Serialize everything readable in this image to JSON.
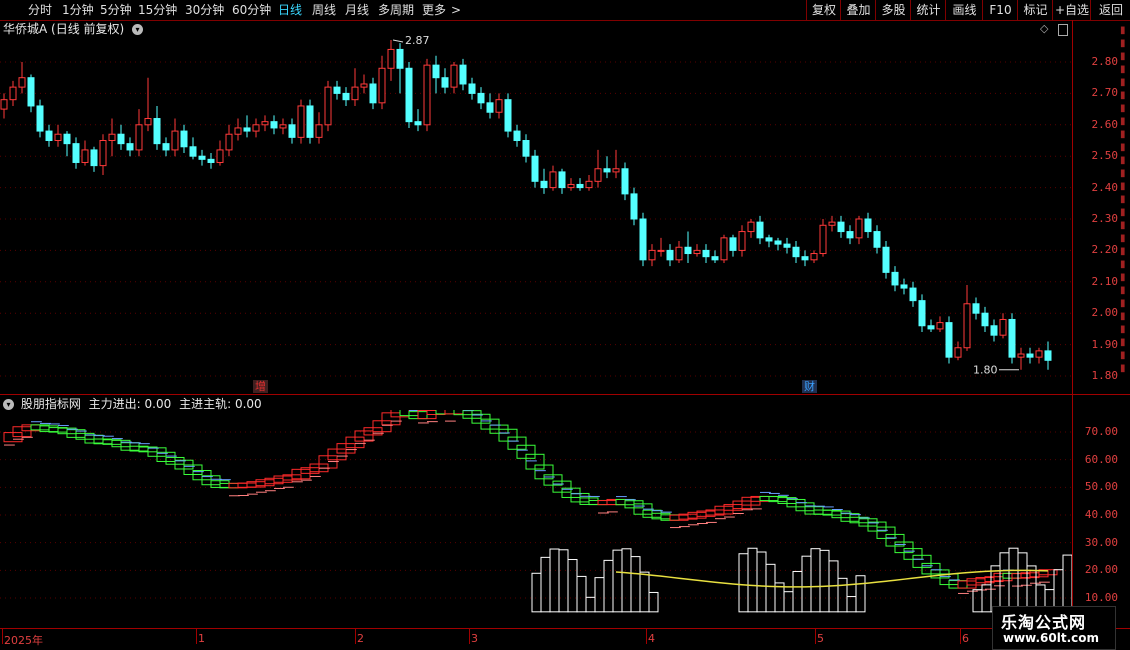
{
  "toolbar": {
    "periods": [
      "分时",
      "1分钟",
      "5分钟",
      "15分钟",
      "30分钟",
      "60分钟",
      "日线",
      "周线",
      "月线",
      "多周期",
      "更多"
    ],
    "active_index": 6,
    "more_arrow": ">",
    "right_buttons": [
      "复权",
      "叠加",
      "多股",
      "统计",
      "画线",
      "F10",
      "标记",
      "+自选",
      "返回"
    ]
  },
  "main_panel": {
    "title": "华侨城A",
    "subtitle": "(日线 前复权)",
    "high_label": "2.87",
    "low_label": "1.80",
    "price_ticks": [
      "2.80",
      "2.70",
      "2.60",
      "2.50",
      "2.40",
      "2.30",
      "2.20",
      "2.10",
      "2.00",
      "1.90",
      "1.80"
    ],
    "tags": [
      {
        "text": "增",
        "color": "#e03030"
      },
      {
        "text": "财",
        "color": "#3aa0ff"
      }
    ]
  },
  "indicator_panel": {
    "name": "股朋指标网",
    "line1_label": "主力进出:",
    "line1_value": "0.00",
    "line2_label": "主进主轨:",
    "line2_value": "0.00",
    "ticks": [
      "70.00",
      "60.00",
      "50.00",
      "40.00",
      "30.00",
      "20.00",
      "10.00"
    ]
  },
  "x_axis": {
    "labels": [
      "2025年",
      "1",
      "2",
      "3",
      "4",
      "5",
      "6"
    ]
  },
  "watermark": {
    "line1": "乐淘公式网",
    "line2": "www.60lt.com"
  },
  "chart_data": {
    "type": "candlestick",
    "title": "华侨城A",
    "ylim": [
      1.78,
      2.9
    ],
    "candles": [
      [
        2.65,
        2.68,
        2.62,
        2.7
      ],
      [
        2.68,
        2.72,
        2.66,
        2.74
      ],
      [
        2.72,
        2.75,
        2.7,
        2.8
      ],
      [
        2.75,
        2.66,
        2.64,
        2.76
      ],
      [
        2.66,
        2.58,
        2.56,
        2.68
      ],
      [
        2.58,
        2.55,
        2.53,
        2.6
      ],
      [
        2.55,
        2.57,
        2.53,
        2.6
      ],
      [
        2.57,
        2.54,
        2.5,
        2.58
      ],
      [
        2.54,
        2.48,
        2.46,
        2.56
      ],
      [
        2.48,
        2.52,
        2.47,
        2.55
      ],
      [
        2.52,
        2.47,
        2.45,
        2.53
      ],
      [
        2.47,
        2.55,
        2.44,
        2.57
      ],
      [
        2.55,
        2.57,
        2.5,
        2.62
      ],
      [
        2.57,
        2.54,
        2.52,
        2.6
      ],
      [
        2.54,
        2.52,
        2.5,
        2.56
      ],
      [
        2.52,
        2.6,
        2.5,
        2.65
      ],
      [
        2.6,
        2.62,
        2.58,
        2.75
      ],
      [
        2.62,
        2.54,
        2.52,
        2.66
      ],
      [
        2.54,
        2.52,
        2.5,
        2.56
      ],
      [
        2.52,
        2.58,
        2.5,
        2.62
      ],
      [
        2.58,
        2.53,
        2.51,
        2.6
      ],
      [
        2.53,
        2.5,
        2.49,
        2.56
      ],
      [
        2.5,
        2.49,
        2.47,
        2.52
      ],
      [
        2.49,
        2.48,
        2.46,
        2.51
      ],
      [
        2.48,
        2.52,
        2.47,
        2.55
      ],
      [
        2.52,
        2.57,
        2.5,
        2.6
      ],
      [
        2.57,
        2.59,
        2.55,
        2.62
      ],
      [
        2.59,
        2.58,
        2.56,
        2.63
      ],
      [
        2.58,
        2.6,
        2.56,
        2.62
      ],
      [
        2.6,
        2.61,
        2.58,
        2.63
      ],
      [
        2.61,
        2.59,
        2.57,
        2.63
      ],
      [
        2.59,
        2.6,
        2.57,
        2.62
      ],
      [
        2.6,
        2.56,
        2.54,
        2.62
      ],
      [
        2.56,
        2.66,
        2.54,
        2.68
      ],
      [
        2.66,
        2.56,
        2.54,
        2.68
      ],
      [
        2.56,
        2.6,
        2.54,
        2.64
      ],
      [
        2.6,
        2.72,
        2.58,
        2.74
      ],
      [
        2.72,
        2.7,
        2.68,
        2.74
      ],
      [
        2.7,
        2.68,
        2.66,
        2.72
      ],
      [
        2.68,
        2.72,
        2.66,
        2.78
      ],
      [
        2.72,
        2.73,
        2.7,
        2.76
      ],
      [
        2.73,
        2.67,
        2.65,
        2.75
      ],
      [
        2.67,
        2.78,
        2.65,
        2.82
      ],
      [
        2.78,
        2.84,
        2.74,
        2.87
      ],
      [
        2.84,
        2.78,
        2.7,
        2.86
      ],
      [
        2.78,
        2.61,
        2.59,
        2.8
      ],
      [
        2.61,
        2.6,
        2.58,
        2.65
      ],
      [
        2.6,
        2.79,
        2.58,
        2.81
      ],
      [
        2.79,
        2.75,
        2.7,
        2.82
      ],
      [
        2.75,
        2.72,
        2.7,
        2.78
      ],
      [
        2.72,
        2.79,
        2.7,
        2.8
      ],
      [
        2.79,
        2.73,
        2.71,
        2.81
      ],
      [
        2.73,
        2.7,
        2.68,
        2.75
      ],
      [
        2.7,
        2.67,
        2.65,
        2.72
      ],
      [
        2.67,
        2.64,
        2.62,
        2.7
      ],
      [
        2.64,
        2.68,
        2.62,
        2.7
      ],
      [
        2.68,
        2.58,
        2.56,
        2.7
      ],
      [
        2.58,
        2.55,
        2.53,
        2.6
      ],
      [
        2.55,
        2.5,
        2.48,
        2.57
      ],
      [
        2.5,
        2.42,
        2.4,
        2.52
      ],
      [
        2.42,
        2.4,
        2.38,
        2.46
      ],
      [
        2.4,
        2.45,
        2.39,
        2.47
      ],
      [
        2.45,
        2.4,
        2.38,
        2.46
      ],
      [
        2.4,
        2.41,
        2.39,
        2.43
      ],
      [
        2.41,
        2.4,
        2.39,
        2.43
      ],
      [
        2.4,
        2.42,
        2.39,
        2.44
      ],
      [
        2.42,
        2.46,
        2.4,
        2.52
      ],
      [
        2.46,
        2.45,
        2.43,
        2.5
      ],
      [
        2.45,
        2.46,
        2.43,
        2.52
      ],
      [
        2.46,
        2.38,
        2.36,
        2.48
      ],
      [
        2.38,
        2.3,
        2.28,
        2.4
      ],
      [
        2.3,
        2.17,
        2.15,
        2.32
      ],
      [
        2.17,
        2.2,
        2.15,
        2.22
      ],
      [
        2.2,
        2.2,
        2.18,
        2.24
      ],
      [
        2.2,
        2.17,
        2.15,
        2.22
      ],
      [
        2.17,
        2.21,
        2.16,
        2.23
      ],
      [
        2.21,
        2.19,
        2.16,
        2.26
      ],
      [
        2.19,
        2.2,
        2.18,
        2.22
      ],
      [
        2.2,
        2.18,
        2.16,
        2.22
      ],
      [
        2.18,
        2.17,
        2.16,
        2.2
      ],
      [
        2.17,
        2.24,
        2.16,
        2.25
      ],
      [
        2.24,
        2.2,
        2.18,
        2.25
      ],
      [
        2.2,
        2.26,
        2.18,
        2.28
      ],
      [
        2.26,
        2.29,
        2.24,
        2.3
      ],
      [
        2.29,
        2.24,
        2.22,
        2.31
      ],
      [
        2.24,
        2.23,
        2.21,
        2.25
      ],
      [
        2.23,
        2.22,
        2.2,
        2.24
      ],
      [
        2.22,
        2.21,
        2.19,
        2.24
      ],
      [
        2.21,
        2.18,
        2.16,
        2.23
      ],
      [
        2.18,
        2.17,
        2.15,
        2.2
      ],
      [
        2.17,
        2.19,
        2.16,
        2.2
      ],
      [
        2.19,
        2.28,
        2.18,
        2.3
      ],
      [
        2.28,
        2.29,
        2.26,
        2.31
      ],
      [
        2.29,
        2.26,
        2.24,
        2.31
      ],
      [
        2.26,
        2.24,
        2.22,
        2.28
      ],
      [
        2.24,
        2.3,
        2.22,
        2.31
      ],
      [
        2.3,
        2.26,
        2.24,
        2.32
      ],
      [
        2.26,
        2.21,
        2.19,
        2.28
      ],
      [
        2.21,
        2.13,
        2.11,
        2.23
      ],
      [
        2.13,
        2.09,
        2.07,
        2.15
      ],
      [
        2.09,
        2.08,
        2.06,
        2.11
      ],
      [
        2.08,
        2.04,
        2.02,
        2.1
      ],
      [
        2.04,
        1.96,
        1.94,
        2.06
      ],
      [
        1.96,
        1.95,
        1.94,
        1.98
      ],
      [
        1.95,
        1.97,
        1.94,
        1.99
      ],
      [
        1.97,
        1.86,
        1.84,
        1.99
      ],
      [
        1.86,
        1.89,
        1.85,
        1.91
      ],
      [
        1.89,
        2.03,
        1.88,
        2.09
      ],
      [
        2.03,
        2.0,
        1.98,
        2.05
      ],
      [
        2.0,
        1.96,
        1.94,
        2.02
      ],
      [
        1.96,
        1.93,
        1.91,
        1.98
      ],
      [
        1.93,
        1.98,
        1.92,
        2.0
      ],
      [
        1.98,
        1.86,
        1.84,
        2.0
      ],
      [
        1.86,
        1.87,
        1.82,
        1.89
      ],
      [
        1.87,
        1.86,
        1.84,
        1.89
      ],
      [
        1.86,
        1.88,
        1.84,
        1.89
      ],
      [
        1.88,
        1.85,
        1.82,
        1.91
      ]
    ]
  }
}
